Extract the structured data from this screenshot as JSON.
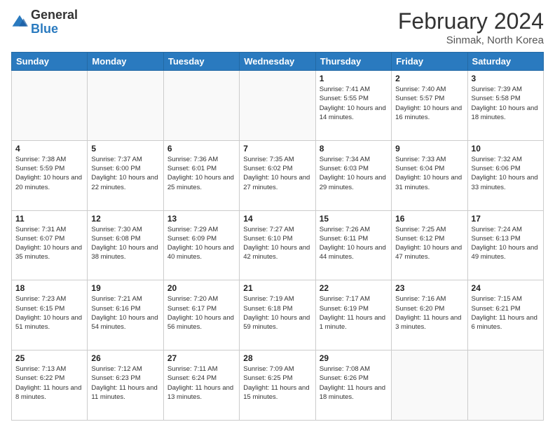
{
  "logo": {
    "general": "General",
    "blue": "Blue"
  },
  "title": {
    "month_year": "February 2024",
    "location": "Sinmak, North Korea"
  },
  "days_of_week": [
    "Sunday",
    "Monday",
    "Tuesday",
    "Wednesday",
    "Thursday",
    "Friday",
    "Saturday"
  ],
  "weeks": [
    [
      {
        "day": "",
        "info": ""
      },
      {
        "day": "",
        "info": ""
      },
      {
        "day": "",
        "info": ""
      },
      {
        "day": "",
        "info": ""
      },
      {
        "day": "1",
        "info": "Sunrise: 7:41 AM\nSunset: 5:55 PM\nDaylight: 10 hours and 14 minutes."
      },
      {
        "day": "2",
        "info": "Sunrise: 7:40 AM\nSunset: 5:57 PM\nDaylight: 10 hours and 16 minutes."
      },
      {
        "day": "3",
        "info": "Sunrise: 7:39 AM\nSunset: 5:58 PM\nDaylight: 10 hours and 18 minutes."
      }
    ],
    [
      {
        "day": "4",
        "info": "Sunrise: 7:38 AM\nSunset: 5:59 PM\nDaylight: 10 hours and 20 minutes."
      },
      {
        "day": "5",
        "info": "Sunrise: 7:37 AM\nSunset: 6:00 PM\nDaylight: 10 hours and 22 minutes."
      },
      {
        "day": "6",
        "info": "Sunrise: 7:36 AM\nSunset: 6:01 PM\nDaylight: 10 hours and 25 minutes."
      },
      {
        "day": "7",
        "info": "Sunrise: 7:35 AM\nSunset: 6:02 PM\nDaylight: 10 hours and 27 minutes."
      },
      {
        "day": "8",
        "info": "Sunrise: 7:34 AM\nSunset: 6:03 PM\nDaylight: 10 hours and 29 minutes."
      },
      {
        "day": "9",
        "info": "Sunrise: 7:33 AM\nSunset: 6:04 PM\nDaylight: 10 hours and 31 minutes."
      },
      {
        "day": "10",
        "info": "Sunrise: 7:32 AM\nSunset: 6:06 PM\nDaylight: 10 hours and 33 minutes."
      }
    ],
    [
      {
        "day": "11",
        "info": "Sunrise: 7:31 AM\nSunset: 6:07 PM\nDaylight: 10 hours and 35 minutes."
      },
      {
        "day": "12",
        "info": "Sunrise: 7:30 AM\nSunset: 6:08 PM\nDaylight: 10 hours and 38 minutes."
      },
      {
        "day": "13",
        "info": "Sunrise: 7:29 AM\nSunset: 6:09 PM\nDaylight: 10 hours and 40 minutes."
      },
      {
        "day": "14",
        "info": "Sunrise: 7:27 AM\nSunset: 6:10 PM\nDaylight: 10 hours and 42 minutes."
      },
      {
        "day": "15",
        "info": "Sunrise: 7:26 AM\nSunset: 6:11 PM\nDaylight: 10 hours and 44 minutes."
      },
      {
        "day": "16",
        "info": "Sunrise: 7:25 AM\nSunset: 6:12 PM\nDaylight: 10 hours and 47 minutes."
      },
      {
        "day": "17",
        "info": "Sunrise: 7:24 AM\nSunset: 6:13 PM\nDaylight: 10 hours and 49 minutes."
      }
    ],
    [
      {
        "day": "18",
        "info": "Sunrise: 7:23 AM\nSunset: 6:15 PM\nDaylight: 10 hours and 51 minutes."
      },
      {
        "day": "19",
        "info": "Sunrise: 7:21 AM\nSunset: 6:16 PM\nDaylight: 10 hours and 54 minutes."
      },
      {
        "day": "20",
        "info": "Sunrise: 7:20 AM\nSunset: 6:17 PM\nDaylight: 10 hours and 56 minutes."
      },
      {
        "day": "21",
        "info": "Sunrise: 7:19 AM\nSunset: 6:18 PM\nDaylight: 10 hours and 59 minutes."
      },
      {
        "day": "22",
        "info": "Sunrise: 7:17 AM\nSunset: 6:19 PM\nDaylight: 11 hours and 1 minute."
      },
      {
        "day": "23",
        "info": "Sunrise: 7:16 AM\nSunset: 6:20 PM\nDaylight: 11 hours and 3 minutes."
      },
      {
        "day": "24",
        "info": "Sunrise: 7:15 AM\nSunset: 6:21 PM\nDaylight: 11 hours and 6 minutes."
      }
    ],
    [
      {
        "day": "25",
        "info": "Sunrise: 7:13 AM\nSunset: 6:22 PM\nDaylight: 11 hours and 8 minutes."
      },
      {
        "day": "26",
        "info": "Sunrise: 7:12 AM\nSunset: 6:23 PM\nDaylight: 11 hours and 11 minutes."
      },
      {
        "day": "27",
        "info": "Sunrise: 7:11 AM\nSunset: 6:24 PM\nDaylight: 11 hours and 13 minutes."
      },
      {
        "day": "28",
        "info": "Sunrise: 7:09 AM\nSunset: 6:25 PM\nDaylight: 11 hours and 15 minutes."
      },
      {
        "day": "29",
        "info": "Sunrise: 7:08 AM\nSunset: 6:26 PM\nDaylight: 11 hours and 18 minutes."
      },
      {
        "day": "",
        "info": ""
      },
      {
        "day": "",
        "info": ""
      }
    ]
  ]
}
